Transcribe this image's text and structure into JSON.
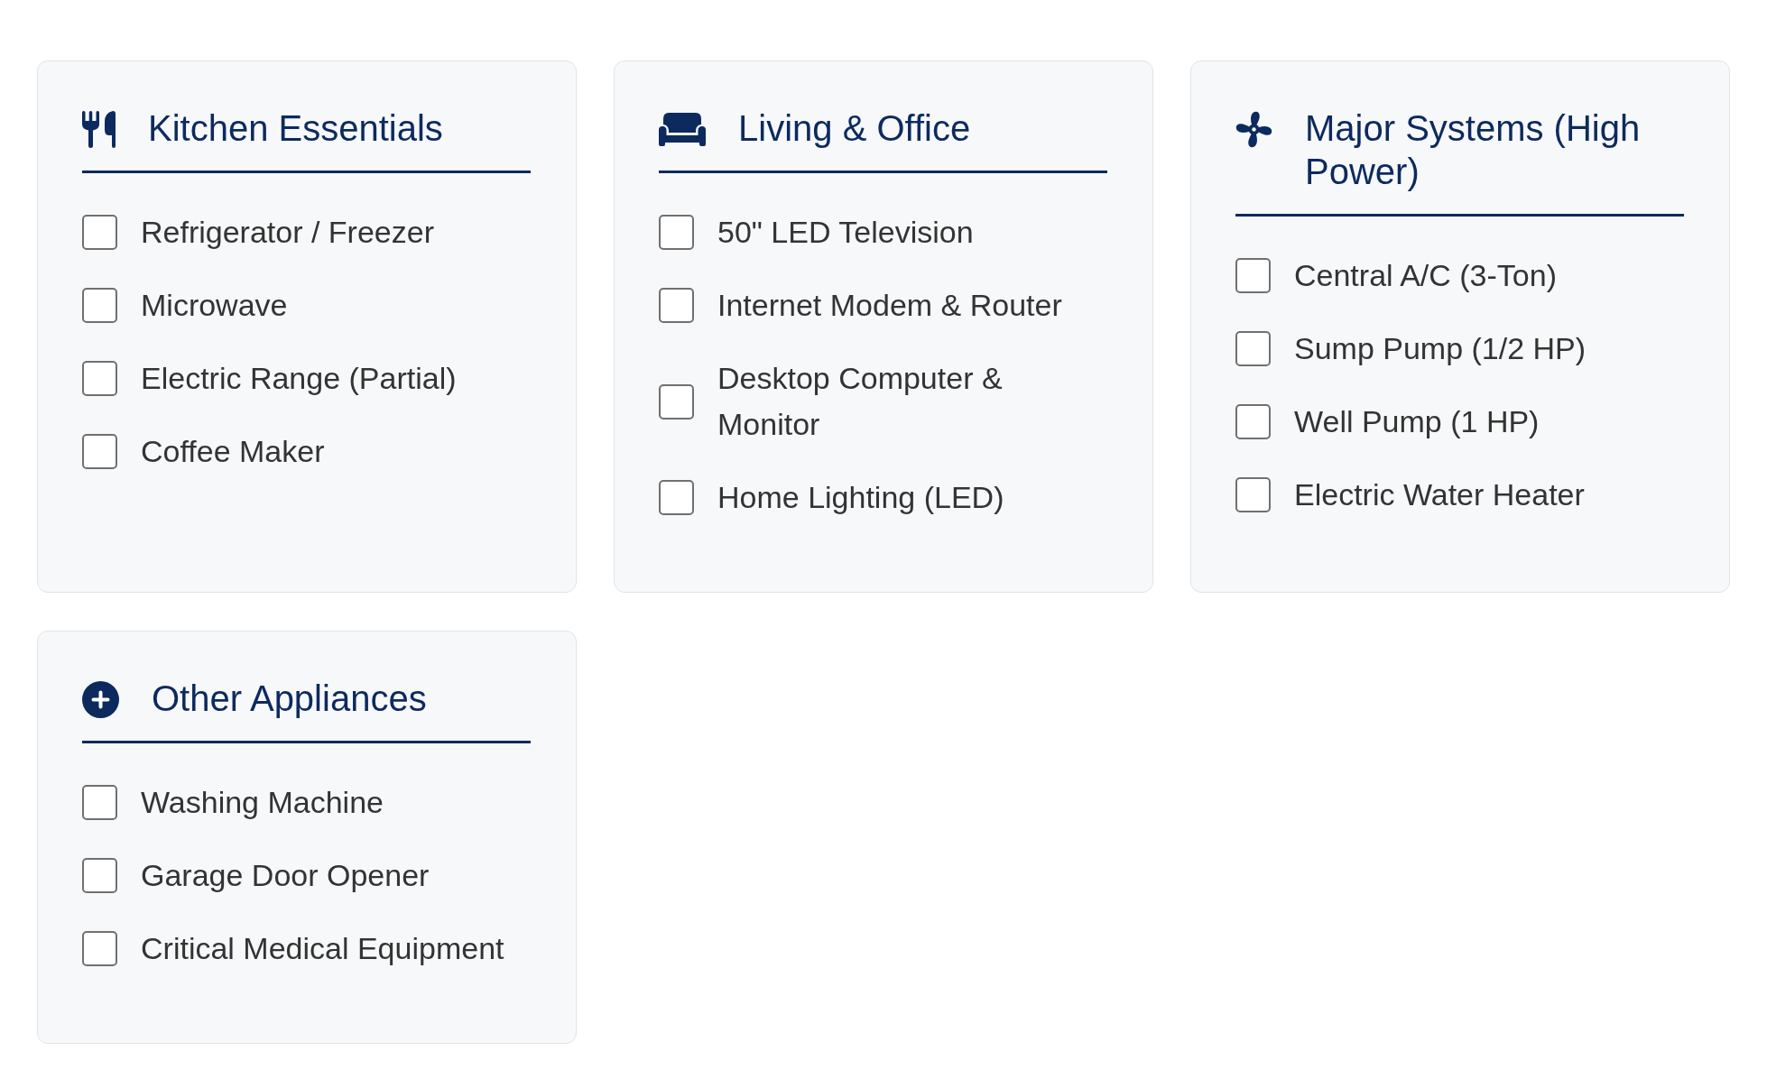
{
  "categories": [
    {
      "title": "Kitchen Essentials",
      "items": [
        {
          "label": "Refrigerator / Freezer",
          "checked": false
        },
        {
          "label": "Microwave",
          "checked": false
        },
        {
          "label": "Electric Range (Partial)",
          "checked": false
        },
        {
          "label": "Coffee Maker",
          "checked": false
        }
      ]
    },
    {
      "title": "Living & Office",
      "items": [
        {
          "label": "50\" LED Television",
          "checked": false
        },
        {
          "label": "Internet Modem & Router",
          "checked": false
        },
        {
          "label": "Desktop Computer & Monitor",
          "checked": false
        },
        {
          "label": "Home Lighting (LED)",
          "checked": false
        }
      ]
    },
    {
      "title": "Major Systems (High Power)",
      "items": [
        {
          "label": "Central A/C (3-Ton)",
          "checked": false
        },
        {
          "label": "Sump Pump (1/2 HP)",
          "checked": false
        },
        {
          "label": "Well Pump (1 HP)",
          "checked": false
        },
        {
          "label": "Electric Water Heater",
          "checked": false
        }
      ]
    },
    {
      "title": "Other Appliances",
      "items": [
        {
          "label": "Washing Machine",
          "checked": false
        },
        {
          "label": "Garage Door Opener",
          "checked": false
        },
        {
          "label": "Critical Medical Equipment",
          "checked": false
        }
      ]
    }
  ]
}
